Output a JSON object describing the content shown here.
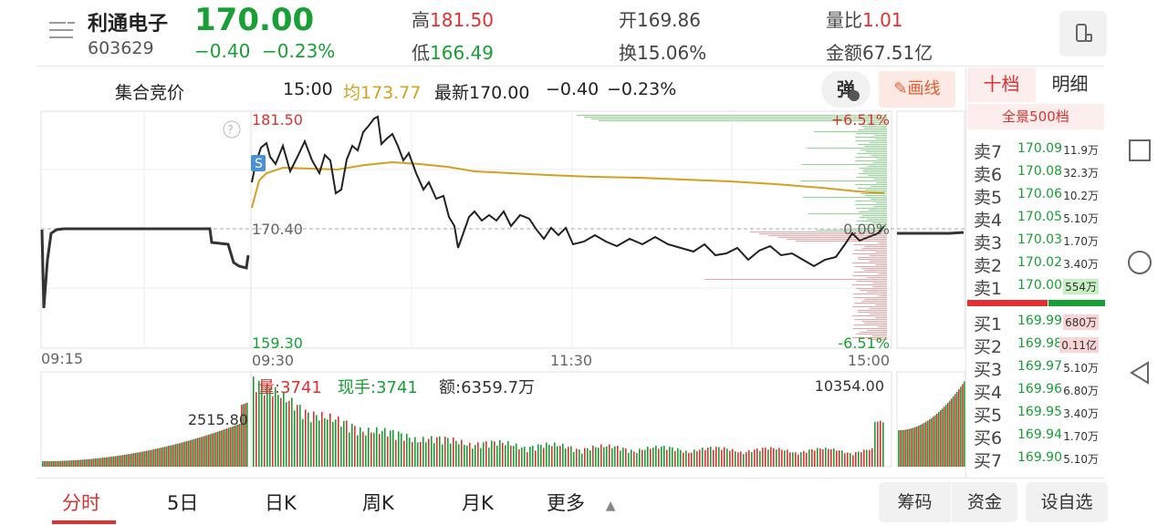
{
  "stock": {
    "name": "利通电子",
    "code": "603629",
    "price": "170.00",
    "change": "−0.40",
    "change_pct": "−0.23%"
  },
  "stats": {
    "high_label": "高",
    "high": "181.50",
    "low_label": "低",
    "low": "166.49",
    "open_label": "开",
    "open": "169.86",
    "turnover_label": "换",
    "turnover": "15.06%",
    "vol_ratio_label": "量比",
    "vol_ratio": "1.01",
    "amount_label": "金额",
    "amount": "67.51亿"
  },
  "toolbar": {
    "auction": "集合竞价",
    "time": "15:00",
    "avg": "均173.77",
    "latest": "最新170.00",
    "chg": "−0.40",
    "chg_pct": "−0.23%",
    "popup": "弹",
    "draw": "画线"
  },
  "chart": {
    "price_high": "181.50",
    "price_mid": "170.40",
    "price_low": "159.30",
    "pct_high": "+6.51%",
    "pct_mid": "0.00%",
    "pct_low": "-6.51%",
    "pre_time": "09:15",
    "t_open": "09:30",
    "t_mid": "11:30",
    "t_close": "15:00",
    "s_marker": "S",
    "help": "?"
  },
  "volume": {
    "vol_text": "量:3741",
    "hand_text": "现手:3741",
    "amount_text": "额:6359.7万",
    "max_vol": "10354.00",
    "pre_vol": "2515.80"
  },
  "orderbook": {
    "tabs": [
      "十档",
      "明细"
    ],
    "full_label": "全景500档",
    "asks": [
      {
        "label": "卖7",
        "price": "170.09",
        "vol": "11.9万"
      },
      {
        "label": "卖6",
        "price": "170.08",
        "vol": "32.3万"
      },
      {
        "label": "卖5",
        "price": "170.06",
        "vol": "10.2万"
      },
      {
        "label": "卖4",
        "price": "170.05",
        "vol": "5.10万"
      },
      {
        "label": "卖3",
        "price": "170.03",
        "vol": "1.70万"
      },
      {
        "label": "卖2",
        "price": "170.02",
        "vol": "3.40万"
      },
      {
        "label": "卖1",
        "price": "170.00",
        "vol": "554万"
      }
    ],
    "bids": [
      {
        "label": "买1",
        "price": "169.99",
        "vol": "680万"
      },
      {
        "label": "买2",
        "price": "169.98",
        "vol": "0.11亿"
      },
      {
        "label": "买3",
        "price": "169.97",
        "vol": "5.10万"
      },
      {
        "label": "买4",
        "price": "169.96",
        "vol": "6.80万"
      },
      {
        "label": "买5",
        "price": "169.95",
        "vol": "3.40万"
      },
      {
        "label": "买6",
        "price": "169.94",
        "vol": "1.70万"
      },
      {
        "label": "买7",
        "price": "169.90",
        "vol": "5.10万"
      }
    ]
  },
  "bottom": {
    "tabs": [
      "分时",
      "5日",
      "日K",
      "周K",
      "月K",
      "更多"
    ],
    "btn_chips": "筹码",
    "btn_funds": "资金",
    "btn_watch": "设自选"
  },
  "colors": {
    "up": "#e03030",
    "down": "#18a035",
    "avg": "#d4a020",
    "accent": "#e85a30"
  }
}
